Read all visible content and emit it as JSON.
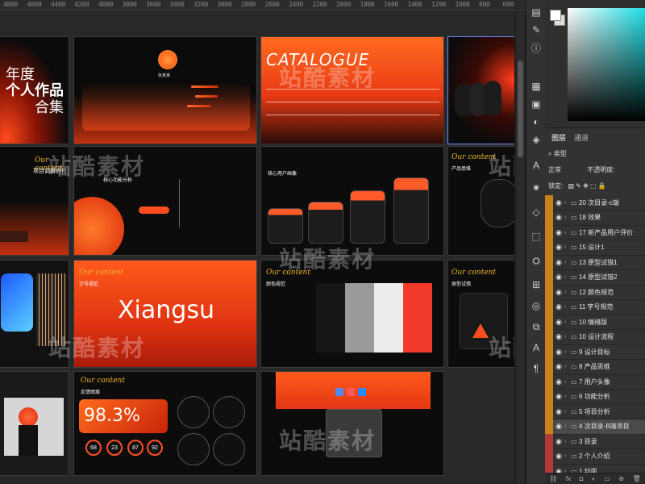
{
  "ruler": {
    "ticks": [
      "4800",
      "4600",
      "4400",
      "4200",
      "4000",
      "3800",
      "3600",
      "3400",
      "3200",
      "3000",
      "2800",
      "2600",
      "2400",
      "2200",
      "2000",
      "1800",
      "1600",
      "1400",
      "1200",
      "1000",
      "800",
      "600"
    ]
  },
  "slides": {
    "cover": {
      "line1": "年度",
      "line2": "个人作品",
      "line3": "合集"
    },
    "profile": {
      "name": "张某某"
    },
    "catalogue": {
      "title": "CATALOGUE"
    },
    "research": {
      "title": "项目调研分析"
    },
    "function": {
      "title": "核心功能分析"
    },
    "persona": {
      "title": "核心用户画像"
    },
    "mind": {
      "title": "产品思维"
    },
    "brand": {
      "word": "Xiangsu",
      "subtitle": "字号规范"
    },
    "color": {
      "title": "颜色规范"
    },
    "proto": {
      "title": "原型试错"
    },
    "feedback": {
      "title": "反馈图案",
      "big": "98.3%",
      "stats": [
        "68",
        "23",
        "87",
        "92"
      ]
    },
    "script_caption": "Our content"
  },
  "watermark": "站酷素材",
  "colors": {
    "accent": "#ff4d1f",
    "deep": "#c21f0a",
    "layer_orange": "#c9821a",
    "layer_red": "#b33a3a"
  },
  "layers": {
    "tabs": [
      "图层",
      "通道"
    ],
    "kind_label": "类型",
    "blend_mode": "正常",
    "opacity_label": "不透明度:",
    "lock_label": "锁定:",
    "items": [
      {
        "name": "20 次目录-c端",
        "color": "orange"
      },
      {
        "name": "18 效果",
        "color": "orange"
      },
      {
        "name": "17 新产品用户评价",
        "color": "orange"
      },
      {
        "name": "15 设计1",
        "color": "orange"
      },
      {
        "name": "13 原型试错1",
        "color": "orange"
      },
      {
        "name": "14 原型试错2",
        "color": "orange"
      },
      {
        "name": "12 颜色规范",
        "color": "orange"
      },
      {
        "name": "11 字号规范",
        "color": "orange"
      },
      {
        "name": "10 情绪版",
        "color": "orange"
      },
      {
        "name": "10 设计流程",
        "color": "orange"
      },
      {
        "name": "9 设计目标",
        "color": "orange"
      },
      {
        "name": "8 产品思维",
        "color": "orange"
      },
      {
        "name": "7 用户头像",
        "color": "orange"
      },
      {
        "name": "6 功能分析",
        "color": "orange"
      },
      {
        "name": "5 项目分析",
        "color": "orange"
      },
      {
        "name": "4 次目录-B端项目",
        "color": "orange"
      },
      {
        "name": "3 目录",
        "color": "red"
      },
      {
        "name": "2 个人介绍",
        "color": "red"
      },
      {
        "name": "1 封面",
        "color": "red"
      }
    ],
    "bottom_icons": [
      "link-icon",
      "fx-icon",
      "mask-icon",
      "adjust-icon",
      "folder-icon",
      "new-layer-icon",
      "trash-icon"
    ]
  }
}
